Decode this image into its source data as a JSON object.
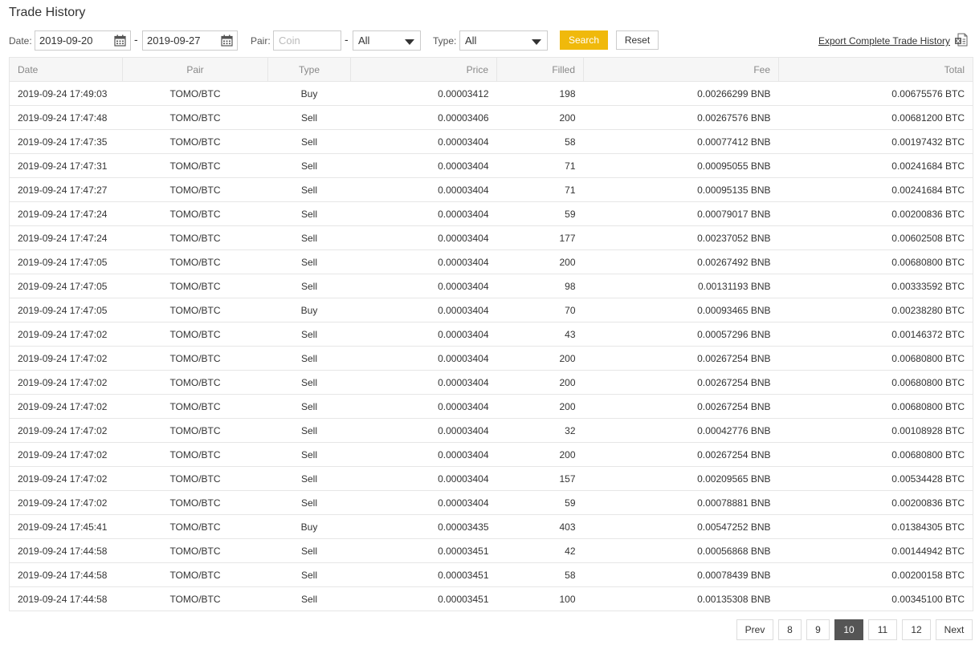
{
  "page": {
    "title": "Trade History"
  },
  "filters": {
    "date_label": "Date:",
    "date_from": "2019-09-20",
    "date_to": "2019-09-27",
    "separator": "-",
    "pair_label": "Pair:",
    "coin_placeholder": "Coin",
    "pair_quote_value": "All",
    "type_label": "Type:",
    "type_value": "All",
    "search_label": "Search",
    "reset_label": "Reset",
    "export_label": "Export Complete Trade History"
  },
  "table": {
    "headers": [
      "Date",
      "Pair",
      "Type",
      "Price",
      "Filled",
      "Fee",
      "Total"
    ],
    "rows": [
      [
        "2019-09-24 17:49:03",
        "TOMO/BTC",
        "Buy",
        "0.00003412",
        "198",
        "0.00266299 BNB",
        "0.00675576 BTC"
      ],
      [
        "2019-09-24 17:47:48",
        "TOMO/BTC",
        "Sell",
        "0.00003406",
        "200",
        "0.00267576 BNB",
        "0.00681200 BTC"
      ],
      [
        "2019-09-24 17:47:35",
        "TOMO/BTC",
        "Sell",
        "0.00003404",
        "58",
        "0.00077412 BNB",
        "0.00197432 BTC"
      ],
      [
        "2019-09-24 17:47:31",
        "TOMO/BTC",
        "Sell",
        "0.00003404",
        "71",
        "0.00095055 BNB",
        "0.00241684 BTC"
      ],
      [
        "2019-09-24 17:47:27",
        "TOMO/BTC",
        "Sell",
        "0.00003404",
        "71",
        "0.00095135 BNB",
        "0.00241684 BTC"
      ],
      [
        "2019-09-24 17:47:24",
        "TOMO/BTC",
        "Sell",
        "0.00003404",
        "59",
        "0.00079017 BNB",
        "0.00200836 BTC"
      ],
      [
        "2019-09-24 17:47:24",
        "TOMO/BTC",
        "Sell",
        "0.00003404",
        "177",
        "0.00237052 BNB",
        "0.00602508 BTC"
      ],
      [
        "2019-09-24 17:47:05",
        "TOMO/BTC",
        "Sell",
        "0.00003404",
        "200",
        "0.00267492 BNB",
        "0.00680800 BTC"
      ],
      [
        "2019-09-24 17:47:05",
        "TOMO/BTC",
        "Sell",
        "0.00003404",
        "98",
        "0.00131193 BNB",
        "0.00333592 BTC"
      ],
      [
        "2019-09-24 17:47:05",
        "TOMO/BTC",
        "Buy",
        "0.00003404",
        "70",
        "0.00093465 BNB",
        "0.00238280 BTC"
      ],
      [
        "2019-09-24 17:47:02",
        "TOMO/BTC",
        "Sell",
        "0.00003404",
        "43",
        "0.00057296 BNB",
        "0.00146372 BTC"
      ],
      [
        "2019-09-24 17:47:02",
        "TOMO/BTC",
        "Sell",
        "0.00003404",
        "200",
        "0.00267254 BNB",
        "0.00680800 BTC"
      ],
      [
        "2019-09-24 17:47:02",
        "TOMO/BTC",
        "Sell",
        "0.00003404",
        "200",
        "0.00267254 BNB",
        "0.00680800 BTC"
      ],
      [
        "2019-09-24 17:47:02",
        "TOMO/BTC",
        "Sell",
        "0.00003404",
        "200",
        "0.00267254 BNB",
        "0.00680800 BTC"
      ],
      [
        "2019-09-24 17:47:02",
        "TOMO/BTC",
        "Sell",
        "0.00003404",
        "32",
        "0.00042776 BNB",
        "0.00108928 BTC"
      ],
      [
        "2019-09-24 17:47:02",
        "TOMO/BTC",
        "Sell",
        "0.00003404",
        "200",
        "0.00267254 BNB",
        "0.00680800 BTC"
      ],
      [
        "2019-09-24 17:47:02",
        "TOMO/BTC",
        "Sell",
        "0.00003404",
        "157",
        "0.00209565 BNB",
        "0.00534428 BTC"
      ],
      [
        "2019-09-24 17:47:02",
        "TOMO/BTC",
        "Sell",
        "0.00003404",
        "59",
        "0.00078881 BNB",
        "0.00200836 BTC"
      ],
      [
        "2019-09-24 17:45:41",
        "TOMO/BTC",
        "Buy",
        "0.00003435",
        "403",
        "0.00547252 BNB",
        "0.01384305 BTC"
      ],
      [
        "2019-09-24 17:44:58",
        "TOMO/BTC",
        "Sell",
        "0.00003451",
        "42",
        "0.00056868 BNB",
        "0.00144942 BTC"
      ],
      [
        "2019-09-24 17:44:58",
        "TOMO/BTC",
        "Sell",
        "0.00003451",
        "58",
        "0.00078439 BNB",
        "0.00200158 BTC"
      ],
      [
        "2019-09-24 17:44:58",
        "TOMO/BTC",
        "Sell",
        "0.00003451",
        "100",
        "0.00135308 BNB",
        "0.00345100 BTC"
      ]
    ]
  },
  "pagination": {
    "items": [
      "Prev",
      "8",
      "9",
      "10",
      "11",
      "12",
      "Next"
    ],
    "current": "10"
  },
  "colors": {
    "accent": "#f0b90b",
    "buy": "#70a800",
    "sell": "#e0249a",
    "active_page": "#555555"
  },
  "icons": {
    "calendar": "calendar-icon",
    "dropdown": "chevron-down-icon",
    "export": "excel-file-icon"
  }
}
